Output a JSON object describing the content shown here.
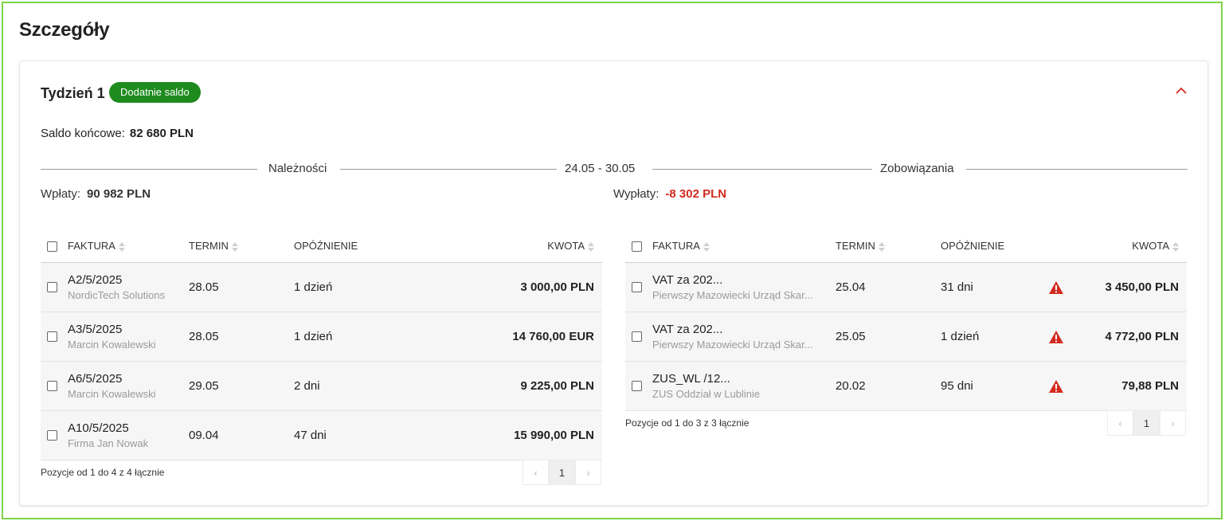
{
  "page": {
    "title": "Szczegóły"
  },
  "week": {
    "title": "Tydzień 1",
    "badge": "Dodatnie saldo",
    "saldo_label": "Saldo końcowe:",
    "saldo_value": "82 680 PLN",
    "range": "24.05 - 30.05",
    "receivables_label": "Należności",
    "liabilities_label": "Zobowiązania",
    "inflow_label": "Wpłaty:",
    "inflow_value": "90 982 PLN",
    "outflow_label": "Wypłaty:",
    "outflow_value": "-8 302 PLN"
  },
  "colors": {
    "accent_green": "#1e8b1e",
    "negative_red": "#d32a1f",
    "frame_green": "#7dd34a"
  },
  "receivables": {
    "headers": {
      "invoice": "FAKTURA",
      "due": "TERMIN",
      "delay": "OPÓŹNIENIE",
      "amount": "KWOTA"
    },
    "rows": [
      {
        "invoice": "A2/5/2025",
        "party": "NordicTech Solutions",
        "due": "28.05",
        "delay": "1 dzień",
        "amount": "3 000,00 PLN"
      },
      {
        "invoice": "A3/5/2025",
        "party": "Marcin Kowalewski",
        "due": "28.05",
        "delay": "1 dzień",
        "amount": "14 760,00 EUR"
      },
      {
        "invoice": "A6/5/2025",
        "party": "Marcin Kowalewski",
        "due": "29.05",
        "delay": "2 dni",
        "amount": "9 225,00 PLN"
      },
      {
        "invoice": "A10/5/2025",
        "party": "Firma Jan Nowak",
        "due": "09.04",
        "delay": "47 dni",
        "amount": "15 990,00 PLN"
      }
    ],
    "footer": "Pozycje od 1 do 4 z 4 łącznie",
    "page": "1"
  },
  "liabilities": {
    "headers": {
      "invoice": "FAKTURA",
      "due": "TERMIN",
      "delay": "OPÓŹNIENIE",
      "amount": "KWOTA"
    },
    "rows": [
      {
        "invoice": "VAT za 202...",
        "party": "Pierwszy Mazowiecki Urząd Skar...",
        "due": "25.04",
        "delay": "31 dni",
        "amount": "3 450,00 PLN",
        "icon": "warning-icon"
      },
      {
        "invoice": "VAT za 202...",
        "party": "Pierwszy Mazowiecki Urząd Skar...",
        "due": "25.05",
        "delay": "1 dzień",
        "amount": "4 772,00 PLN",
        "icon": "warning-icon"
      },
      {
        "invoice": "ZUS_WL /12...",
        "party": "ZUS Oddział w Lublinie",
        "due": "20.02",
        "delay": "95 dni",
        "amount": "79,88 PLN",
        "icon": "warning-icon"
      }
    ],
    "footer": "Pozycje od 1 do 3 z 3 łącznie",
    "page": "1"
  }
}
